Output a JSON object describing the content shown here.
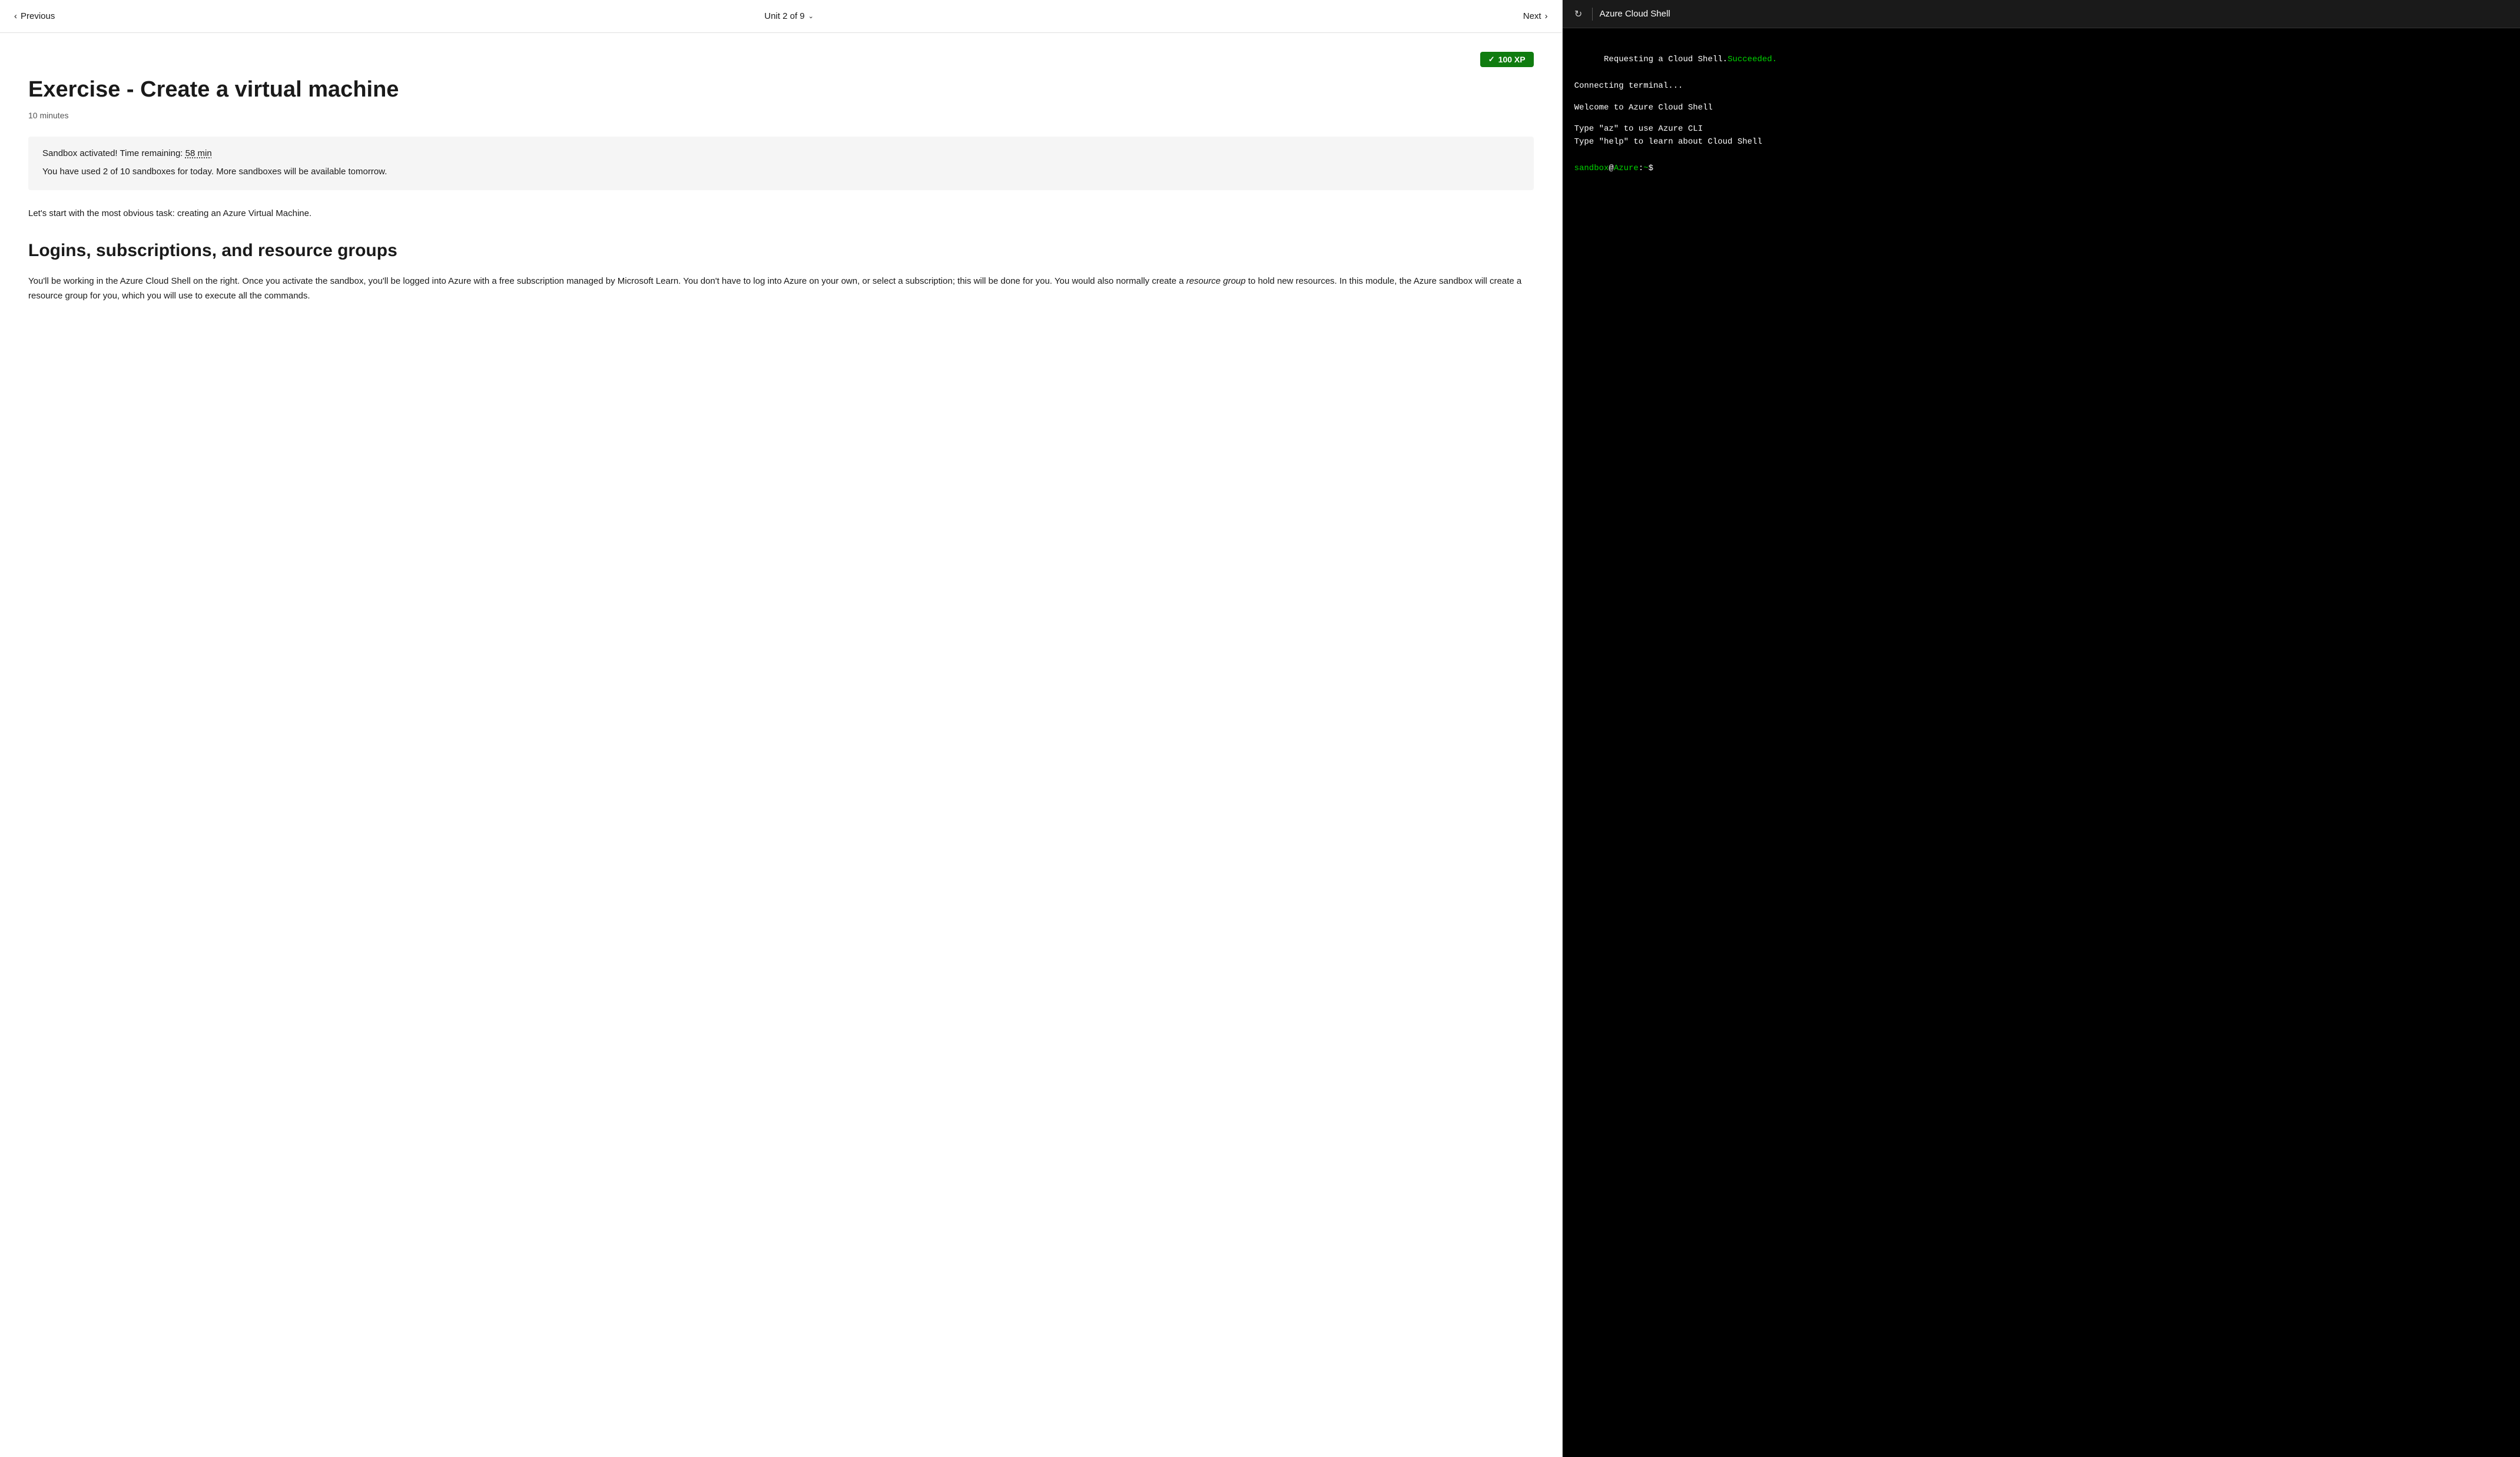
{
  "nav": {
    "prev_label": "Previous",
    "next_label": "Next",
    "unit_label": "Unit 2 of 9"
  },
  "xp_badge": {
    "value": "100 XP"
  },
  "content": {
    "title": "Exercise - Create a virtual machine",
    "time_estimate": "10 minutes",
    "sandbox": {
      "time_label": "Sandbox activated! Time remaining:",
      "time_value": "58 min",
      "usage_text": "You have used 2 of 10 sandboxes for today. More sandboxes will be available tomorrow."
    },
    "intro": "Let's start with the most obvious task: creating an Azure Virtual Machine.",
    "section_heading": "Logins, subscriptions, and resource groups",
    "body_text_1": "You'll be working in the Azure Cloud Shell on the right. Once you activate the sandbox, you'll be logged into Azure with a free subscription managed by Microsoft Learn. You don't have to log into Azure on your own, or select a subscription; this will be done for you. You would also normally create a ",
    "body_italic": "resource group",
    "body_text_2": " to hold new resources. In this module, the Azure sandbox will create a resource group for you, which you will use to execute all the commands."
  },
  "shell": {
    "title": "Azure Cloud Shell",
    "line1": "Requesting a Cloud Shell.",
    "line1_success": "Succeeded.",
    "line2": "Connecting terminal...",
    "blank1": "",
    "line3": "Welcome to Azure Cloud Shell",
    "blank2": "",
    "line4": "Type \"az\" to use Azure CLI",
    "line5": "Type \"help\" to learn about Cloud Shell",
    "blank3": "",
    "prompt_sandbox": "sandbox",
    "prompt_at": "@",
    "prompt_azure": "Azure",
    "prompt_colon": ":",
    "prompt_tilde": "~",
    "prompt_dollar": "$"
  }
}
